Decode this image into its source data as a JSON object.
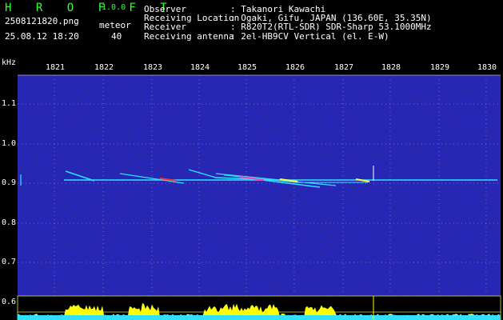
{
  "header": {
    "app_letters": "H R O F F T",
    "version": "1.0.0",
    "filename": "2508121820.png",
    "datetime": "25.08.12 18:20",
    "meteor_label": "meteor",
    "meteor_count": "40"
  },
  "info": {
    "rows": [
      {
        "label": "Observer",
        "value": ": Takanori Kawachi"
      },
      {
        "label": "Receiving Location",
        "value": ": Ogaki, Gifu, JAPAN (136.60E, 35.35N)"
      },
      {
        "label": "Receiver",
        "value": ": R820T2(RTL-SDR) SDR-Sharp 53.1000MHz"
      },
      {
        "label": "Receiving antenna",
        "value": ": 2el-HB9CV Vertical (el. E-W)"
      }
    ]
  },
  "axes": {
    "y_unit": "kHz",
    "y_ticks": [
      "1.1",
      "1.0",
      "0.9",
      "0.8",
      "0.7",
      "0.6"
    ],
    "x_ticks": [
      "1821",
      "1822",
      "1823",
      "1824",
      "1825",
      "1826",
      "1827",
      "1828",
      "1829",
      "1830"
    ]
  },
  "colors": {
    "background": "#000000",
    "plot_background": "#0a0a6e",
    "header_green": "#33ff33",
    "header_white": "#ffffff",
    "signal_cyan": "#30e0ff",
    "level_yellow": "#ffff00"
  }
}
